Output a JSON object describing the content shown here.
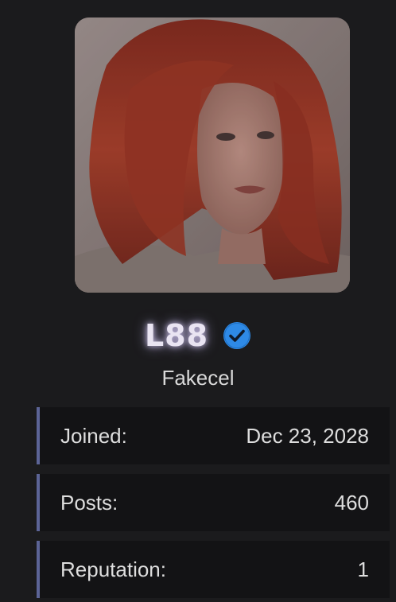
{
  "profile": {
    "username": "L88",
    "user_title": "Fakecel",
    "verified": true
  },
  "stats": [
    {
      "label": "Joined:",
      "value": "Dec 23, 2028"
    },
    {
      "label": "Posts:",
      "value": "460"
    },
    {
      "label": "Reputation:",
      "value": "1"
    }
  ],
  "icons": {
    "verified": "check-badge-icon"
  },
  "colors": {
    "background": "#1b1b1d",
    "row_background": "#131315",
    "row_accent": "#5c6496",
    "verified_blue": "#2e8ae6",
    "username_glow": "#d2c8f0"
  }
}
